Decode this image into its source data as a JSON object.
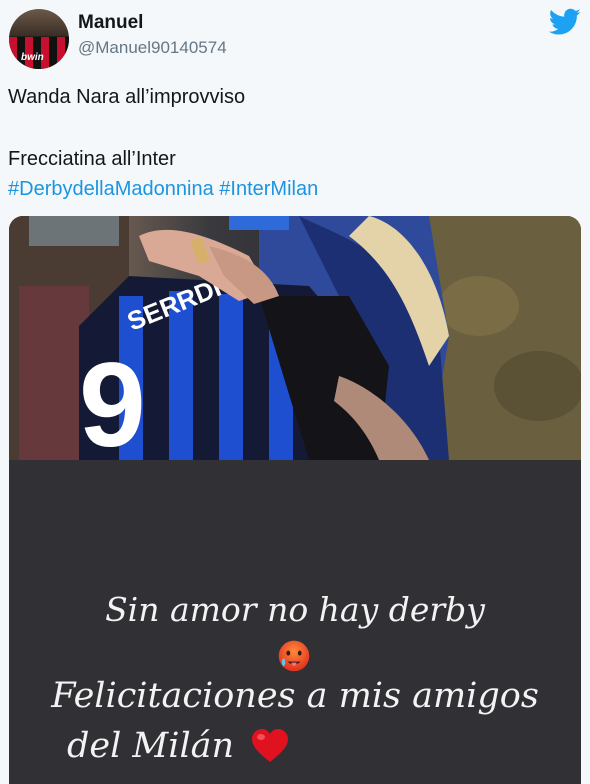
{
  "user": {
    "display_name": "Manuel",
    "handle": "@Manuel90140574",
    "avatar_sponsor": "bwin"
  },
  "tweet": {
    "line1": "Wanda Nara all’improvviso",
    "line2": "Frecciatina all’Inter",
    "hashtags": [
      "#DerbydellaMadonnina",
      "#InterMilan"
    ]
  },
  "media": {
    "jersey_name": "SERRDI",
    "jersey_number": "9",
    "caption_line1": "Sin amor no hay derby",
    "caption_line2": "Felicitaciones a mis amigos",
    "caption_line3": "del Milán"
  },
  "colors": {
    "hashtag": "#1b95e0",
    "twitter_brand": "#1da1f2",
    "story_background": "#303035"
  },
  "icons": {
    "brand": "twitter-bird-icon",
    "caption_emoji": "hot-face-emoji",
    "caption_heart": "red-heart-emoji"
  }
}
